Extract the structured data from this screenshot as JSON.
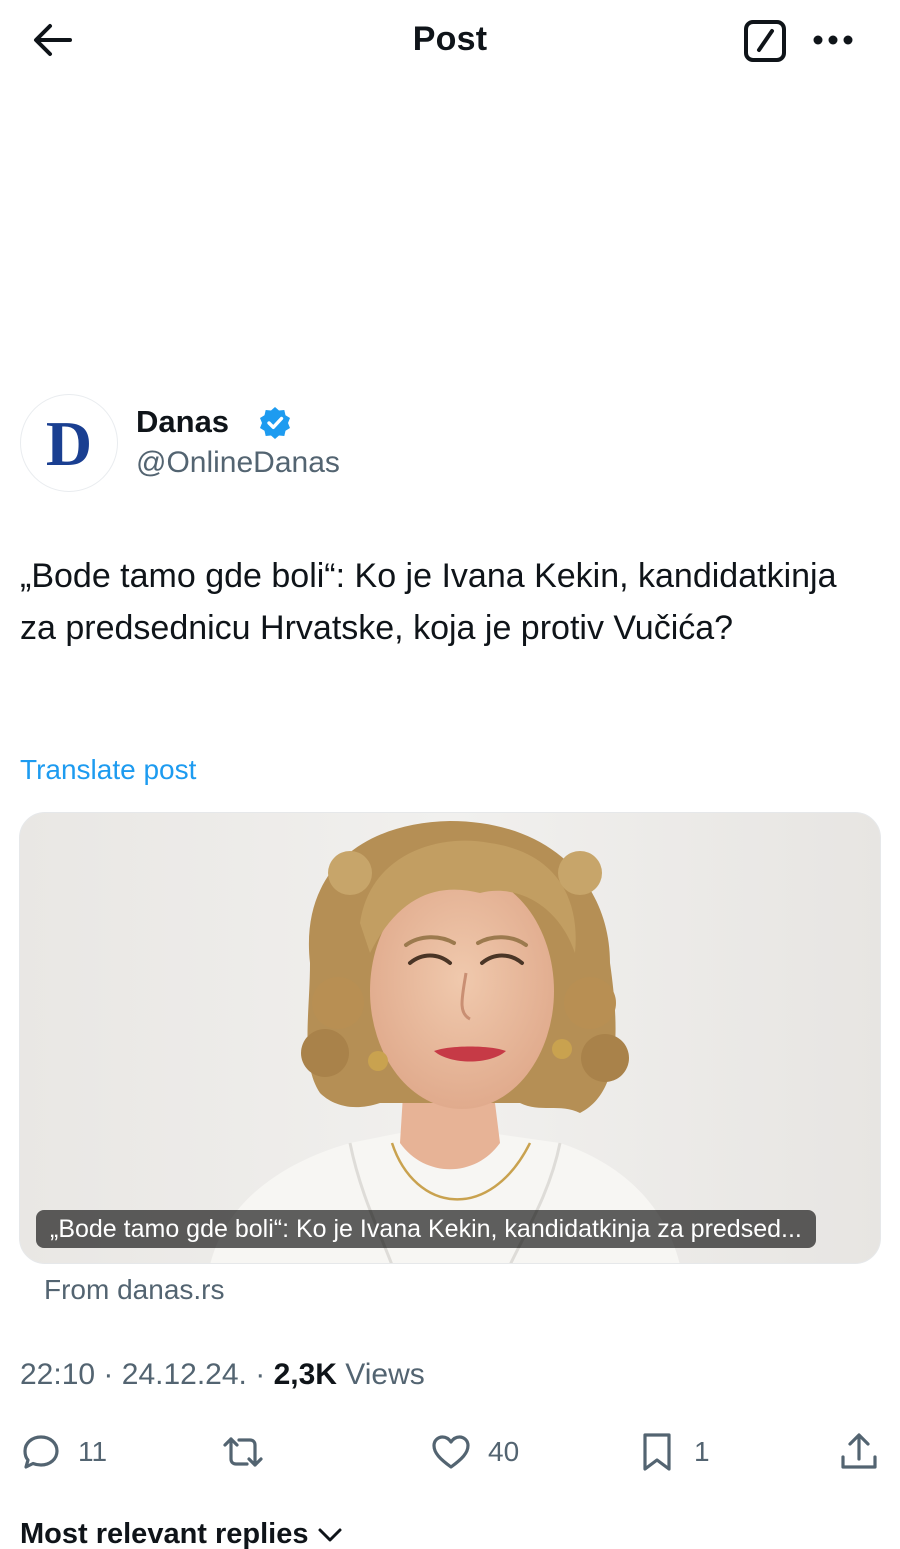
{
  "header": {
    "title": "Post",
    "back_icon": "arrow-left-icon",
    "compose_icon": "compose-icon",
    "more_icon": "more-horizontal-icon"
  },
  "author": {
    "avatar_letter": "D",
    "display_name": "Danas",
    "handle": "@OnlineDanas",
    "verified": true,
    "verified_color": "#1d9bf0"
  },
  "post": {
    "text": "„Bode tamo gde boli“: Ko je Ivana Kekin, kandidatkinja za predsednicu Hrvatske, koja je protiv Vučića?",
    "translate_label": "Translate post"
  },
  "link_card": {
    "caption": "„Bode tamo gde boli“: Ko je Ivana Kekin, kandidatkinja za predsed...",
    "source": "From danas.rs"
  },
  "meta": {
    "time": "22:10",
    "separator": "·",
    "date": "24.12.24.",
    "views_count": "2,3K",
    "views_label": "Views"
  },
  "actions": {
    "replies": "11",
    "reposts": "",
    "likes": "40",
    "bookmarks": "1"
  },
  "replies_sort": {
    "label": "Most relevant replies"
  },
  "colors": {
    "accent": "#1d9bf0",
    "text_primary": "#0f1419",
    "text_secondary": "#536471"
  }
}
